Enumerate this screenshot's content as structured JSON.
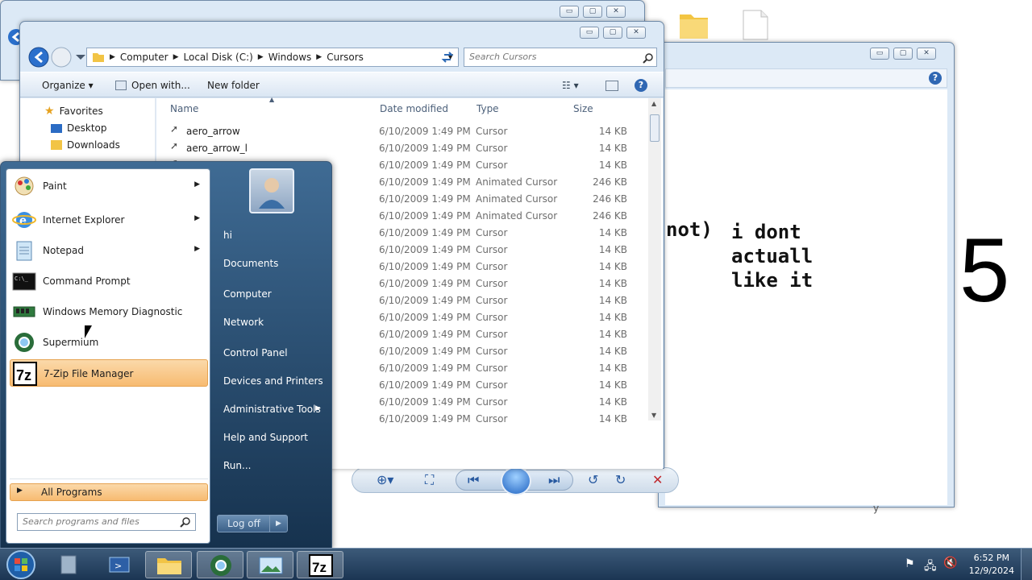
{
  "window_controls": {
    "minimize": "▭",
    "maximize": "▢",
    "close": "✕"
  },
  "explorer": {
    "breadcrumb": [
      "Computer",
      "Local Disk (C:)",
      "Windows",
      "Cursors"
    ],
    "search_placeholder": "Search Cursors",
    "toolbar": {
      "organize": "Organize ▾",
      "open_with": "Open with...",
      "new_folder": "New folder"
    },
    "nav": [
      {
        "label": "Favorites",
        "icon": "star-icon"
      },
      {
        "label": "Desktop",
        "icon": "desktop-icon"
      },
      {
        "label": "Downloads",
        "icon": "downloads-icon"
      }
    ],
    "columns": [
      "Name",
      "Date modified",
      "Type",
      "Size"
    ],
    "rows": [
      {
        "name": "aero_arrow",
        "date": "6/10/2009 1:49 PM",
        "type": "Cursor",
        "size": "14 KB"
      },
      {
        "name": "aero_arrow_l",
        "date": "6/10/2009 1:49 PM",
        "type": "Cursor",
        "size": "14 KB"
      },
      {
        "name": "",
        "date": "6/10/2009 1:49 PM",
        "type": "Cursor",
        "size": "14 KB"
      },
      {
        "name": "",
        "date": "6/10/2009 1:49 PM",
        "type": "Animated Cursor",
        "size": "246 KB"
      },
      {
        "name": "",
        "date": "6/10/2009 1:49 PM",
        "type": "Animated Cursor",
        "size": "246 KB"
      },
      {
        "name": "",
        "date": "6/10/2009 1:49 PM",
        "type": "Animated Cursor",
        "size": "246 KB"
      },
      {
        "name": "",
        "date": "6/10/2009 1:49 PM",
        "type": "Cursor",
        "size": "14 KB"
      },
      {
        "name": "",
        "date": "6/10/2009 1:49 PM",
        "type": "Cursor",
        "size": "14 KB"
      },
      {
        "name": "",
        "date": "6/10/2009 1:49 PM",
        "type": "Cursor",
        "size": "14 KB"
      },
      {
        "name": "",
        "date": "6/10/2009 1:49 PM",
        "type": "Cursor",
        "size": "14 KB"
      },
      {
        "name": "",
        "date": "6/10/2009 1:49 PM",
        "type": "Cursor",
        "size": "14 KB"
      },
      {
        "name": "",
        "date": "6/10/2009 1:49 PM",
        "type": "Cursor",
        "size": "14 KB"
      },
      {
        "name": "",
        "date": "6/10/2009 1:49 PM",
        "type": "Cursor",
        "size": "14 KB"
      },
      {
        "name": "",
        "date": "6/10/2009 1:49 PM",
        "type": "Cursor",
        "size": "14 KB"
      },
      {
        "name": "",
        "date": "6/10/2009 1:49 PM",
        "type": "Cursor",
        "size": "14 KB"
      },
      {
        "name": "",
        "date": "6/10/2009 1:49 PM",
        "type": "Cursor",
        "size": "14 KB"
      },
      {
        "name": "",
        "date": "6/10/2009 1:49 PM",
        "type": "Cursor",
        "size": "14 KB"
      },
      {
        "name": "",
        "date": "6/10/2009 1:49 PM",
        "type": "Cursor",
        "size": "14 KB"
      }
    ]
  },
  "photo_viewer": {
    "image_text": {
      "line0": "not)",
      "line1": "i dont",
      "line2": "actuall",
      "line3": "like it"
    },
    "big_number": "5",
    "stray_char": "y"
  },
  "start_menu": {
    "programs": [
      {
        "label": "Paint",
        "icon": "paint-icon",
        "arrow": "▶"
      },
      {
        "label": "Internet Explorer",
        "icon": "internet-explorer-icon",
        "arrow": "▶"
      },
      {
        "label": "Notepad",
        "icon": "notepad-icon",
        "arrow": "▶"
      },
      {
        "label": "Command Prompt",
        "icon": "command-prompt-icon",
        "arrow": ""
      },
      {
        "label": "Windows Memory Diagnostic",
        "icon": "memory-diagnostic-icon",
        "arrow": ""
      },
      {
        "label": "Supermium",
        "icon": "supermium-icon",
        "arrow": ""
      },
      {
        "label": "7-Zip File Manager",
        "icon": "7zip-icon",
        "arrow": ""
      }
    ],
    "all_programs": "All Programs",
    "search_placeholder": "Search programs and files",
    "right_items": [
      "hi",
      "Documents",
      "Computer",
      "Network",
      "Control Panel",
      "Devices and Printers",
      "Administrative Tools",
      "Help and Support",
      "Run..."
    ],
    "admin_arrow": "▶",
    "log_off": "Log off",
    "log_off_arrow": "▶"
  },
  "taskbar": {
    "time": "6:52 PM",
    "date": "12/9/2024",
    "sevenzip_label": "7z"
  }
}
